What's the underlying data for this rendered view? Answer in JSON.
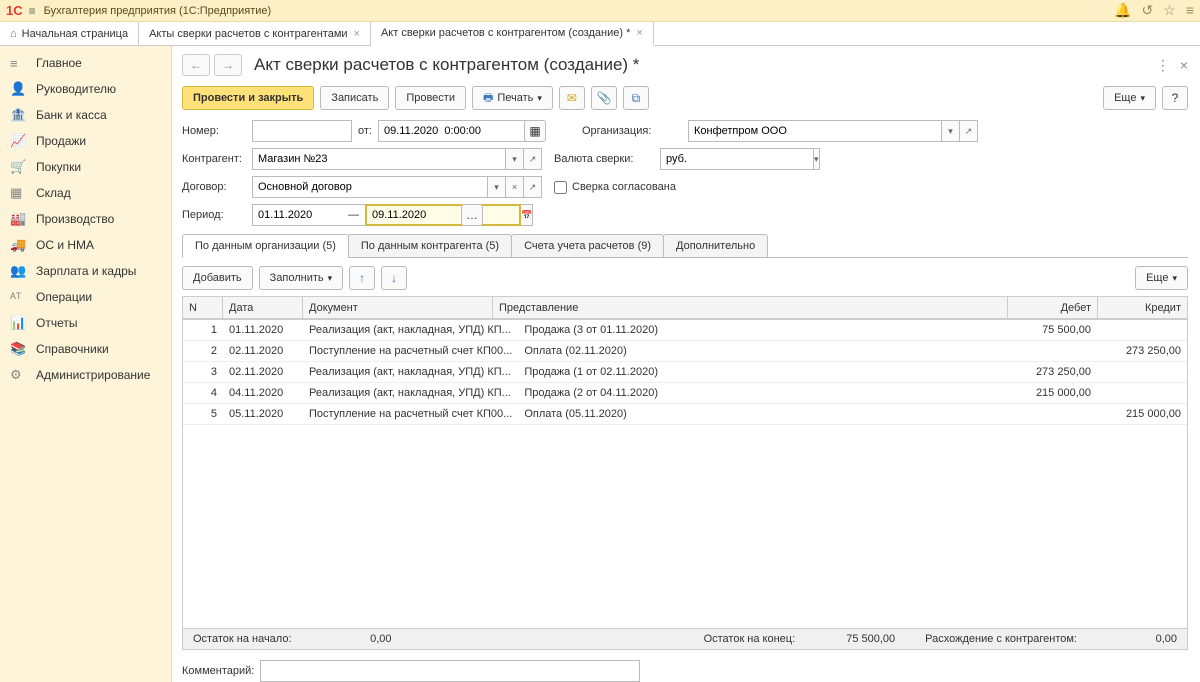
{
  "app": {
    "title": "Бухгалтерия предприятия (1С:Предприятие)"
  },
  "tabs": {
    "home": "Начальная страница",
    "tab1": "Акты сверки расчетов с контрагентами",
    "tab2": "Акт сверки расчетов с контрагентом (создание) *"
  },
  "sidebar": [
    {
      "icon": "≡",
      "label": "Главное"
    },
    {
      "icon": "👤",
      "label": "Руководителю"
    },
    {
      "icon": "🏦",
      "label": "Банк и касса"
    },
    {
      "icon": "📈",
      "label": "Продажи"
    },
    {
      "icon": "🛒",
      "label": "Покупки"
    },
    {
      "icon": "▦",
      "label": "Склад"
    },
    {
      "icon": "🏭",
      "label": "Производство"
    },
    {
      "icon": "🚚",
      "label": "ОС и НМА"
    },
    {
      "icon": "👥",
      "label": "Зарплата и кадры"
    },
    {
      "icon": "ᴬᵀ",
      "label": "Операции"
    },
    {
      "icon": "📊",
      "label": "Отчеты"
    },
    {
      "icon": "📚",
      "label": "Справочники"
    },
    {
      "icon": "⚙",
      "label": "Администрирование"
    }
  ],
  "page": {
    "title": "Акт сверки расчетов с контрагентом (создание) *"
  },
  "toolbar": {
    "post_close": "Провести и закрыть",
    "save": "Записать",
    "post": "Провести",
    "print": "Печать",
    "more": "Еще"
  },
  "form": {
    "number_label": "Номер:",
    "number_value": "",
    "from_label": "от:",
    "date_value": "09.11.2020  0:00:00",
    "org_label": "Организация:",
    "org_value": "Конфетпром ООО",
    "counterparty_label": "Контрагент:",
    "counterparty_value": "Магазин №23",
    "currency_label": "Валюта сверки:",
    "currency_value": "руб.",
    "contract_label": "Договор:",
    "contract_value": "Основной договор",
    "approved_label": "Сверка согласована",
    "period_label": "Период:",
    "period_from": "01.11.2020",
    "period_sep": "—",
    "period_to": "09.11.2020"
  },
  "subtabs": [
    "По данным организации (5)",
    "По данным контрагента (5)",
    "Счета учета расчетов (9)",
    "Дополнительно"
  ],
  "table_toolbar": {
    "add": "Добавить",
    "fill": "Заполнить",
    "more": "Еще"
  },
  "columns": {
    "n": "N",
    "date": "Дата",
    "doc": "Документ",
    "repr": "Представление",
    "debit": "Дебет",
    "credit": "Кредит"
  },
  "rows": [
    {
      "n": "1",
      "date": "01.11.2020",
      "doc": "Реализация (акт, накладная, УПД) КП...",
      "repr": "Продажа (3 от 01.11.2020)",
      "debit": "75 500,00",
      "credit": ""
    },
    {
      "n": "2",
      "date": "02.11.2020",
      "doc": "Поступление на расчетный счет КП00...",
      "repr": "Оплата (02.11.2020)",
      "debit": "",
      "credit": "273 250,00"
    },
    {
      "n": "3",
      "date": "02.11.2020",
      "doc": "Реализация (акт, накладная, УПД) КП...",
      "repr": "Продажа (1 от 02.11.2020)",
      "debit": "273 250,00",
      "credit": ""
    },
    {
      "n": "4",
      "date": "04.11.2020",
      "doc": "Реализация (акт, накладная, УПД) КП...",
      "repr": "Продажа (2 от 04.11.2020)",
      "debit": "215 000,00",
      "credit": ""
    },
    {
      "n": "5",
      "date": "05.11.2020",
      "doc": "Поступление на расчетный счет КП00...",
      "repr": "Оплата (05.11.2020)",
      "debit": "",
      "credit": "215 000,00"
    }
  ],
  "summary": {
    "bal_start_label": "Остаток на начало:",
    "bal_start_value": "0,00",
    "bal_end_label": "Остаток на конец:",
    "bal_end_value": "75 500,00",
    "diff_label": "Расхождение с контрагентом:",
    "diff_value": "0,00"
  },
  "comment_label": "Комментарий:",
  "comment_value": ""
}
